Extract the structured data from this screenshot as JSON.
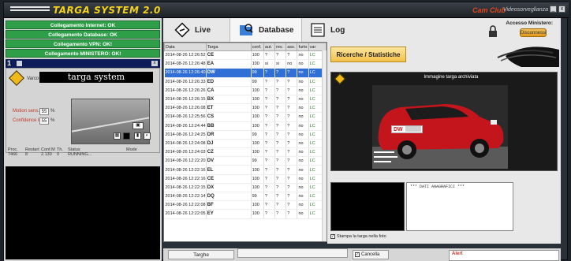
{
  "app": {
    "title": "TARGA SYSTEM 2.0",
    "brand": "Cam Club",
    "brand_sub": "Videosorveglianza"
  },
  "status_lines": [
    "Collegamento Internet: OK",
    "Collegamento Database: OK",
    "Collegamento VPN: OK!",
    "Collegamento MINISTERO: OK!"
  ],
  "camera": {
    "number": "1",
    "varco_label": "Varco",
    "plate_text": "targa system",
    "motion_label": "Motion sens.",
    "motion_value": "55",
    "confidence_label": "Confidence level",
    "confidence_value": "55",
    "unit": "%",
    "stats_headers": [
      "Proc.",
      "Restart",
      "Conf.M",
      "Th.",
      "Status",
      "Mode"
    ],
    "stats_values": [
      "7466",
      "8",
      "2.130",
      "0",
      "RUNNING...",
      ""
    ]
  },
  "tabs": {
    "live": "Live",
    "database": "Database",
    "log": "Log"
  },
  "access": {
    "label": "Accesso Ministero:",
    "button": "Disconnessi"
  },
  "table": {
    "headers": [
      "Data",
      "Targa",
      "conf.",
      "aut.",
      "rev.",
      "ass.",
      "furto",
      "var"
    ],
    "rows": [
      {
        "date": "2014-08-26 12:26:52",
        "plate": "CE",
        "conf": "100",
        "a": "?",
        "b": "?",
        "c": "?",
        "d": "no",
        "e": "LC"
      },
      {
        "date": "2014-08-26 12:26:48",
        "plate": "EA",
        "conf": "100",
        "a": "si",
        "b": "si",
        "c": "no",
        "d": "no",
        "e": "LC"
      },
      {
        "date": "2014-08-26 12:26:40",
        "plate": "DW",
        "conf": "99",
        "a": "?",
        "b": "?",
        "c": "?",
        "d": "no",
        "e": "LC",
        "selected": true
      },
      {
        "date": "2014-08-26 12:26:33",
        "plate": "ED",
        "conf": "99",
        "a": "?",
        "b": "?",
        "c": "?",
        "d": "no",
        "e": "LC"
      },
      {
        "date": "2014-08-26 12:26:26",
        "plate": "CA",
        "conf": "100",
        "a": "?",
        "b": "?",
        "c": "?",
        "d": "no",
        "e": "LC"
      },
      {
        "date": "2014-08-26 12:26:15",
        "plate": "BX",
        "conf": "100",
        "a": "?",
        "b": "?",
        "c": "?",
        "d": "no",
        "e": "LC"
      },
      {
        "date": "2014-08-26 12:26:08",
        "plate": "ET",
        "conf": "100",
        "a": "?",
        "b": "?",
        "c": "?",
        "d": "no",
        "e": "LC"
      },
      {
        "date": "2014-08-26 12:25:56",
        "plate": "CS",
        "conf": "100",
        "a": "?",
        "b": "?",
        "c": "?",
        "d": "no",
        "e": "LC"
      },
      {
        "date": "2014-08-26 12:24:44",
        "plate": "BB",
        "conf": "100",
        "a": "?",
        "b": "?",
        "c": "?",
        "d": "no",
        "e": "LC"
      },
      {
        "date": "2014-08-26 12:24:25",
        "plate": "DR",
        "conf": "99",
        "a": "?",
        "b": "?",
        "c": "?",
        "d": "no",
        "e": "LC"
      },
      {
        "date": "2014-08-26 12:24:08",
        "plate": "DJ",
        "conf": "100",
        "a": "?",
        "b": "?",
        "c": "?",
        "d": "no",
        "e": "LC"
      },
      {
        "date": "2014-08-26 12:24:03",
        "plate": "CZ",
        "conf": "100",
        "a": "?",
        "b": "?",
        "c": "?",
        "d": "no",
        "e": "LC"
      },
      {
        "date": "2014-08-26 12:22:20",
        "plate": "DV",
        "conf": "99",
        "a": "?",
        "b": "?",
        "c": "?",
        "d": "no",
        "e": "LC"
      },
      {
        "date": "2014-08-26 12:22:16",
        "plate": "EL",
        "conf": "100",
        "a": "?",
        "b": "?",
        "c": "?",
        "d": "no",
        "e": "LC"
      },
      {
        "date": "2014-08-26 12:22:16",
        "plate": "CE",
        "conf": "100",
        "a": "?",
        "b": "?",
        "c": "?",
        "d": "no",
        "e": "LC"
      },
      {
        "date": "2014-08-26 12:22:15",
        "plate": "DX",
        "conf": "100",
        "a": "?",
        "b": "?",
        "c": "?",
        "d": "no",
        "e": "LC"
      },
      {
        "date": "2014-08-26 12:22:14",
        "plate": "DQ",
        "conf": "99",
        "a": "?",
        "b": "?",
        "c": "?",
        "d": "no",
        "e": "LC"
      },
      {
        "date": "2014-08-26 12:22:08",
        "plate": "BF",
        "conf": "100",
        "a": "?",
        "b": "?",
        "c": "?",
        "d": "no",
        "e": "LC"
      },
      {
        "date": "2014-08-26 12:22:05",
        "plate": "EY",
        "conf": "100",
        "a": "?",
        "b": "?",
        "c": "?",
        "d": "no",
        "e": "LC"
      }
    ]
  },
  "right": {
    "ricerche_button": "Ricerche / Statistiche",
    "image_title": "Immagine targa archiviata",
    "image_plate": "DW",
    "dati_title": "*** DATI ANAGRAFICI ***",
    "stampa_label": "Stampa la targa nella foto"
  },
  "bottom": {
    "targhe_label": "Targhe",
    "cancella_label": "Cancella",
    "alert_label": "Alert"
  },
  "colors": {
    "status_green": "#2e9e48",
    "selection_blue": "#2f6fd6",
    "accent_orange": "#f4c24a",
    "title_yellow": "#f2d21a"
  }
}
